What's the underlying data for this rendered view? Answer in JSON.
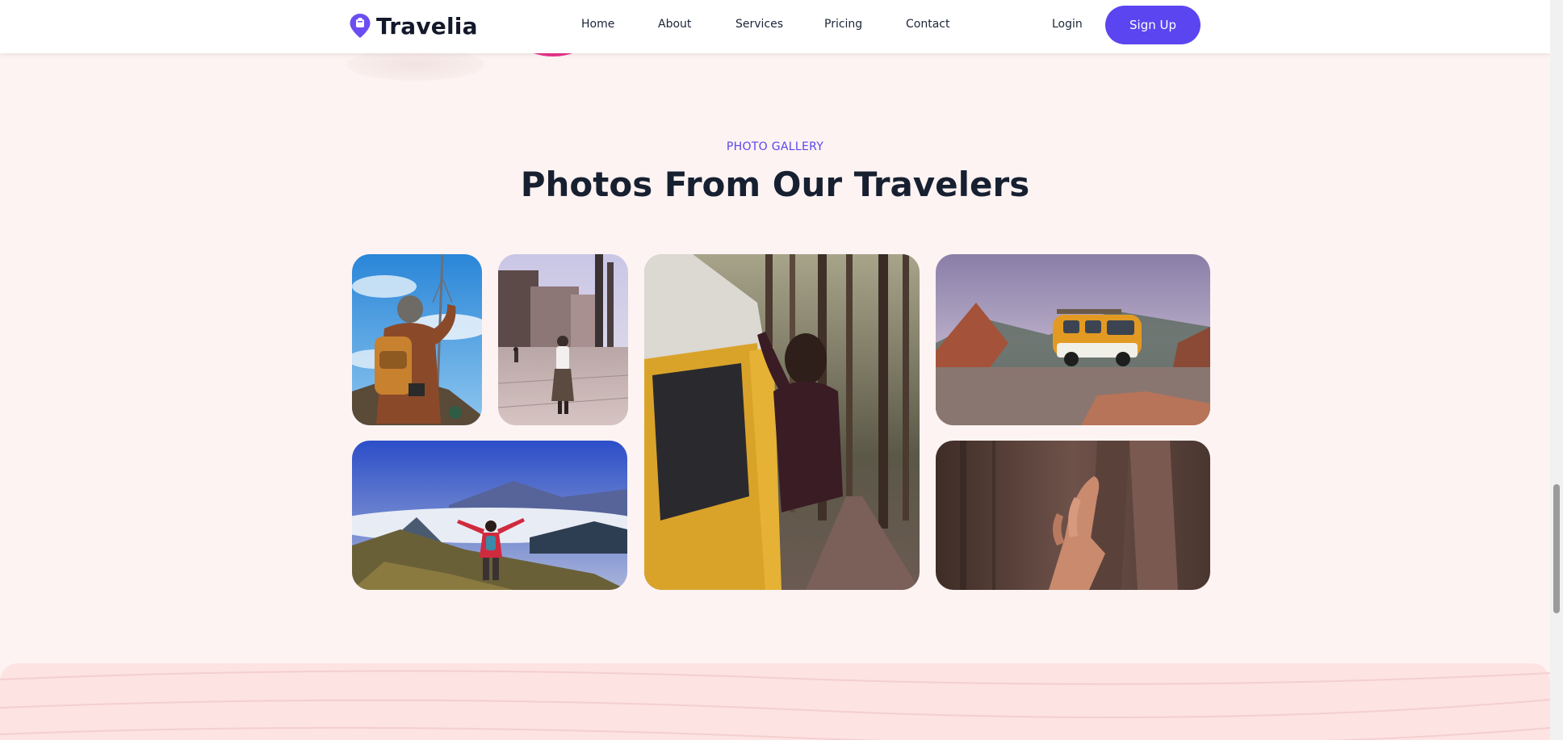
{
  "brand": {
    "name": "Travelia",
    "color": "#5b45f0"
  },
  "nav": {
    "items": [
      "Home",
      "About",
      "Services",
      "Pricing",
      "Contact"
    ],
    "login": "Login",
    "signup": "Sign Up"
  },
  "gallery": {
    "eyebrow": "PHOTO GALLERY",
    "title": "Photos From Our Travelers",
    "photos": [
      {
        "subject": "hiker-with-backpack-and-tower"
      },
      {
        "subject": "woman-walking-in-plaza"
      },
      {
        "subject": "woman-leaning-out-of-van-in-forest"
      },
      {
        "subject": "orange-van-on-rocky-hill"
      },
      {
        "subject": "hiker-above-clouds"
      },
      {
        "subject": "hand-on-rock"
      }
    ]
  },
  "colors": {
    "background": "#fdf3f2",
    "accent": "#5b45f0",
    "heading": "#172031"
  }
}
